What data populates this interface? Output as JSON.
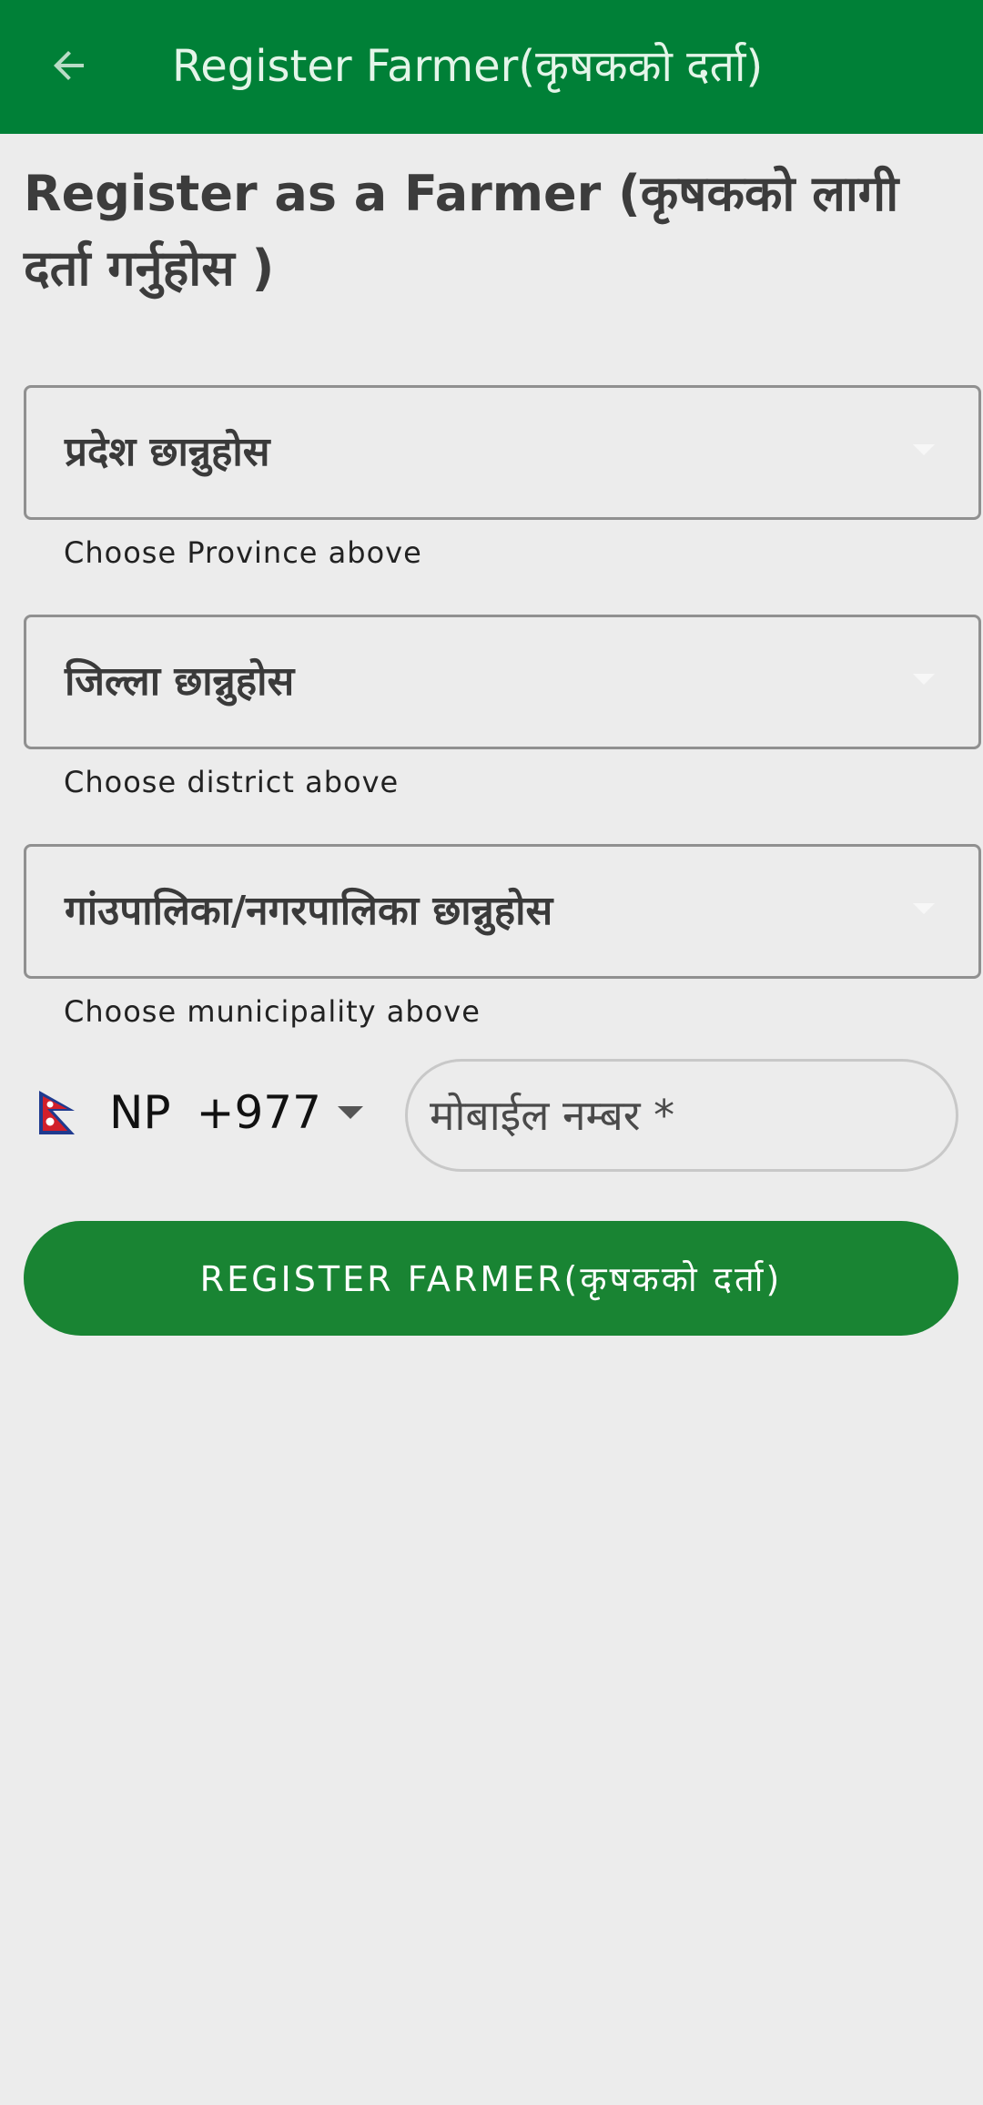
{
  "appbar": {
    "title": "Register Farmer(कृषकको दर्ता)",
    "back_icon": "arrow-back-icon",
    "background": "#008037"
  },
  "heading": "Register as a Farmer (कृषकको लागी दर्ता गर्नुहोस )",
  "form": {
    "province": {
      "placeholder": "प्रदेश छान्नुहोस",
      "helper": "Choose Province above"
    },
    "district": {
      "placeholder": "जिल्ला छान्नुहोस",
      "helper": "Choose district above"
    },
    "municipality": {
      "placeholder": "गांउपालिका/नगरपालिका छान्नुहोस",
      "helper": "Choose municipality above"
    },
    "country": {
      "iso": "NP",
      "dial_code": "+977",
      "flag_icon": "nepal-flag-icon"
    },
    "mobile": {
      "placeholder": "मोबाईल नम्बर *",
      "value": ""
    },
    "submit_label": "REGISTER FARMER(कृषकको दर्ता)"
  },
  "colors": {
    "primary": "#008037",
    "button": "#198433",
    "background": "#ececec"
  }
}
